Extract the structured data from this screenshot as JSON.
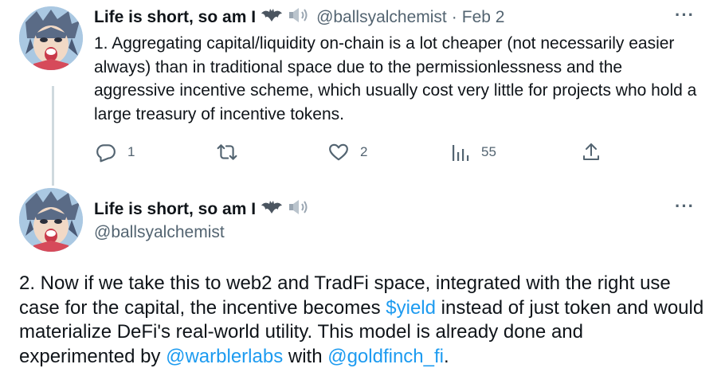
{
  "tweet1": {
    "author_name": "Life is short, so am I",
    "handle": "@ballsyalchemist",
    "separator": "·",
    "date": "Feb 2",
    "text": "1. Aggregating capital/liquidity on-chain is a lot cheaper (not necessarily easier always) than in traditional space due to the permissionlessness and the aggressive incentive scheme, which usually cost very little for projects who hold a large treasury of incentive tokens.",
    "actions": {
      "replies": "1",
      "retweets": "",
      "likes": "2",
      "views": "55"
    }
  },
  "tweet2": {
    "author_name": "Life is short, so am I",
    "handle": "@ballsyalchemist",
    "text_parts": {
      "p1": "2. Now if we take this to web2 and TradFi space, integrated with the right use case for the capital, the incentive becomes ",
      "cashtag": "$yield",
      "p2": " instead of just token and would materialize DeFi's real-world utility. This model is already done and experimented by ",
      "mention1": "@warblerlabs",
      "p3": " with ",
      "mention2": "@goldfinch_fi",
      "p4": "."
    }
  },
  "more_glyph": "···",
  "colors": {
    "text": "#0f1419",
    "secondary": "#536471",
    "link": "#1d9bf0",
    "thread_line": "#cfd9de"
  },
  "icons": [
    "reply-icon",
    "retweet-icon",
    "like-icon",
    "views-icon",
    "share-icon",
    "more-icon",
    "bat-emoji-icon",
    "speaker-emoji-icon"
  ]
}
